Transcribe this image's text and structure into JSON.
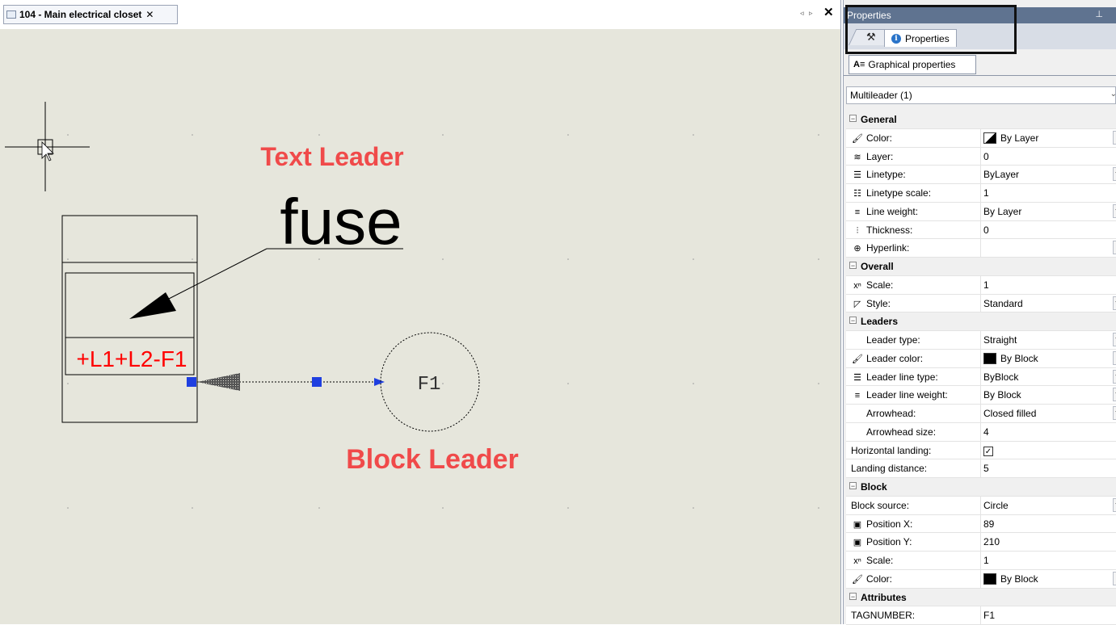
{
  "document": {
    "tab_title": "104 - Main electrical closet",
    "tab_close": "✕",
    "nav_arrows": "◃ ▹",
    "close_all": "✕"
  },
  "drawing": {
    "text_leader_caption": "Text Leader",
    "block_leader_caption": "Block Leader",
    "leader_text": "fuse",
    "block_label": "+L1+L2-F1",
    "block_tag": "F1",
    "caption_color": "#f04a4a",
    "label_color": "#ff0000",
    "grip_color": "#1f3fe0"
  },
  "panel": {
    "title": "Properties",
    "pin_icon": "pin-icon",
    "tab_properties": "Properties",
    "subtab_graphical": "Graphical properties",
    "object_selector": "Multileader (1)",
    "sections": [
      {
        "name": "General",
        "rows": [
          {
            "label": "Color:",
            "value": "By Layer",
            "icon": "color-icon",
            "swatch": "bylayer"
          },
          {
            "label": "Layer:",
            "value": "0",
            "icon": "layer-icon"
          },
          {
            "label": "Linetype:",
            "value": "ByLayer",
            "icon": "linetype-icon"
          },
          {
            "label": "Linetype scale:",
            "value": "1",
            "icon": "linetype-scale-icon"
          },
          {
            "label": "Line weight:",
            "value": "By Layer",
            "icon": "lineweight-icon"
          },
          {
            "label": "Thickness:",
            "value": "0",
            "icon": "thickness-icon"
          },
          {
            "label": "Hyperlink:",
            "value": "",
            "icon": "hyperlink-icon"
          }
        ]
      },
      {
        "name": "Overall",
        "rows": [
          {
            "label": "Scale:",
            "value": "1",
            "icon": "scale-icon"
          },
          {
            "label": "Style:",
            "value": "Standard",
            "icon": "style-icon"
          }
        ]
      },
      {
        "name": "Leaders",
        "rows": [
          {
            "label": "Leader type:",
            "value": "Straight",
            "icon": "blank"
          },
          {
            "label": "Leader color:",
            "value": "By Block",
            "icon": "color-icon",
            "swatch": "black"
          },
          {
            "label": "Leader line type:",
            "value": "ByBlock",
            "icon": "linetype-icon"
          },
          {
            "label": "Leader line weight:",
            "value": "By Block",
            "icon": "lineweight-icon"
          },
          {
            "label": "Arrowhead:",
            "value": "Closed filled",
            "icon": "blank"
          },
          {
            "label": "Arrowhead size:",
            "value": "4",
            "icon": "blank"
          },
          {
            "label": "Horizontal landing:",
            "value": "☑",
            "icon": "none",
            "checkbox": true
          },
          {
            "label": "Landing distance:",
            "value": "5",
            "icon": "none"
          }
        ]
      },
      {
        "name": "Block",
        "rows": [
          {
            "label": "Block source:",
            "value": "Circle",
            "icon": "none"
          },
          {
            "label": "Position X:",
            "value": "89",
            "icon": "position-x-icon"
          },
          {
            "label": "Position Y:",
            "value": "210",
            "icon": "position-y-icon"
          },
          {
            "label": "Scale:",
            "value": "1",
            "icon": "scale-icon"
          },
          {
            "label": "Color:",
            "value": "By Block",
            "icon": "color-icon",
            "swatch": "black"
          }
        ]
      },
      {
        "name": "Attributes",
        "rows": [
          {
            "label": "TAGNUMBER:",
            "value": "F1",
            "icon": "none"
          }
        ]
      }
    ]
  }
}
